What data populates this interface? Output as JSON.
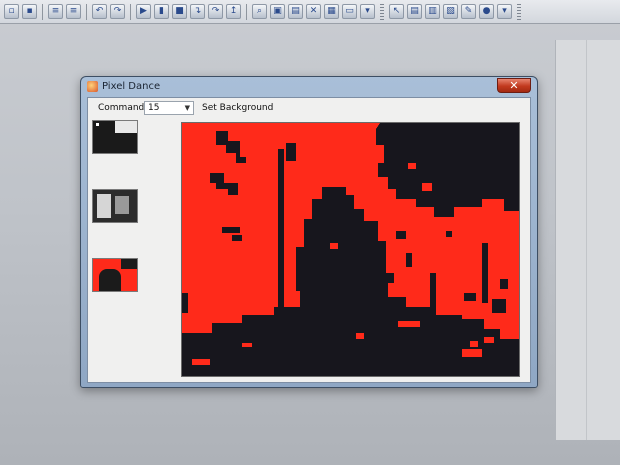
{
  "window": {
    "title": "Pixel Dance",
    "close_glyph": "✕"
  },
  "toolbar": {
    "command_label": "Command",
    "command_value": "15",
    "set_background_label": "Set Background"
  },
  "icons": [
    "save-icon",
    "undo-icon",
    "redo-icon",
    "run-icon",
    "pause-icon",
    "stop-icon",
    "step-icon",
    "tools-icon",
    "window-icon"
  ],
  "colors": {
    "display_red": "#ff2a1a",
    "display_dark": "#17161d"
  }
}
